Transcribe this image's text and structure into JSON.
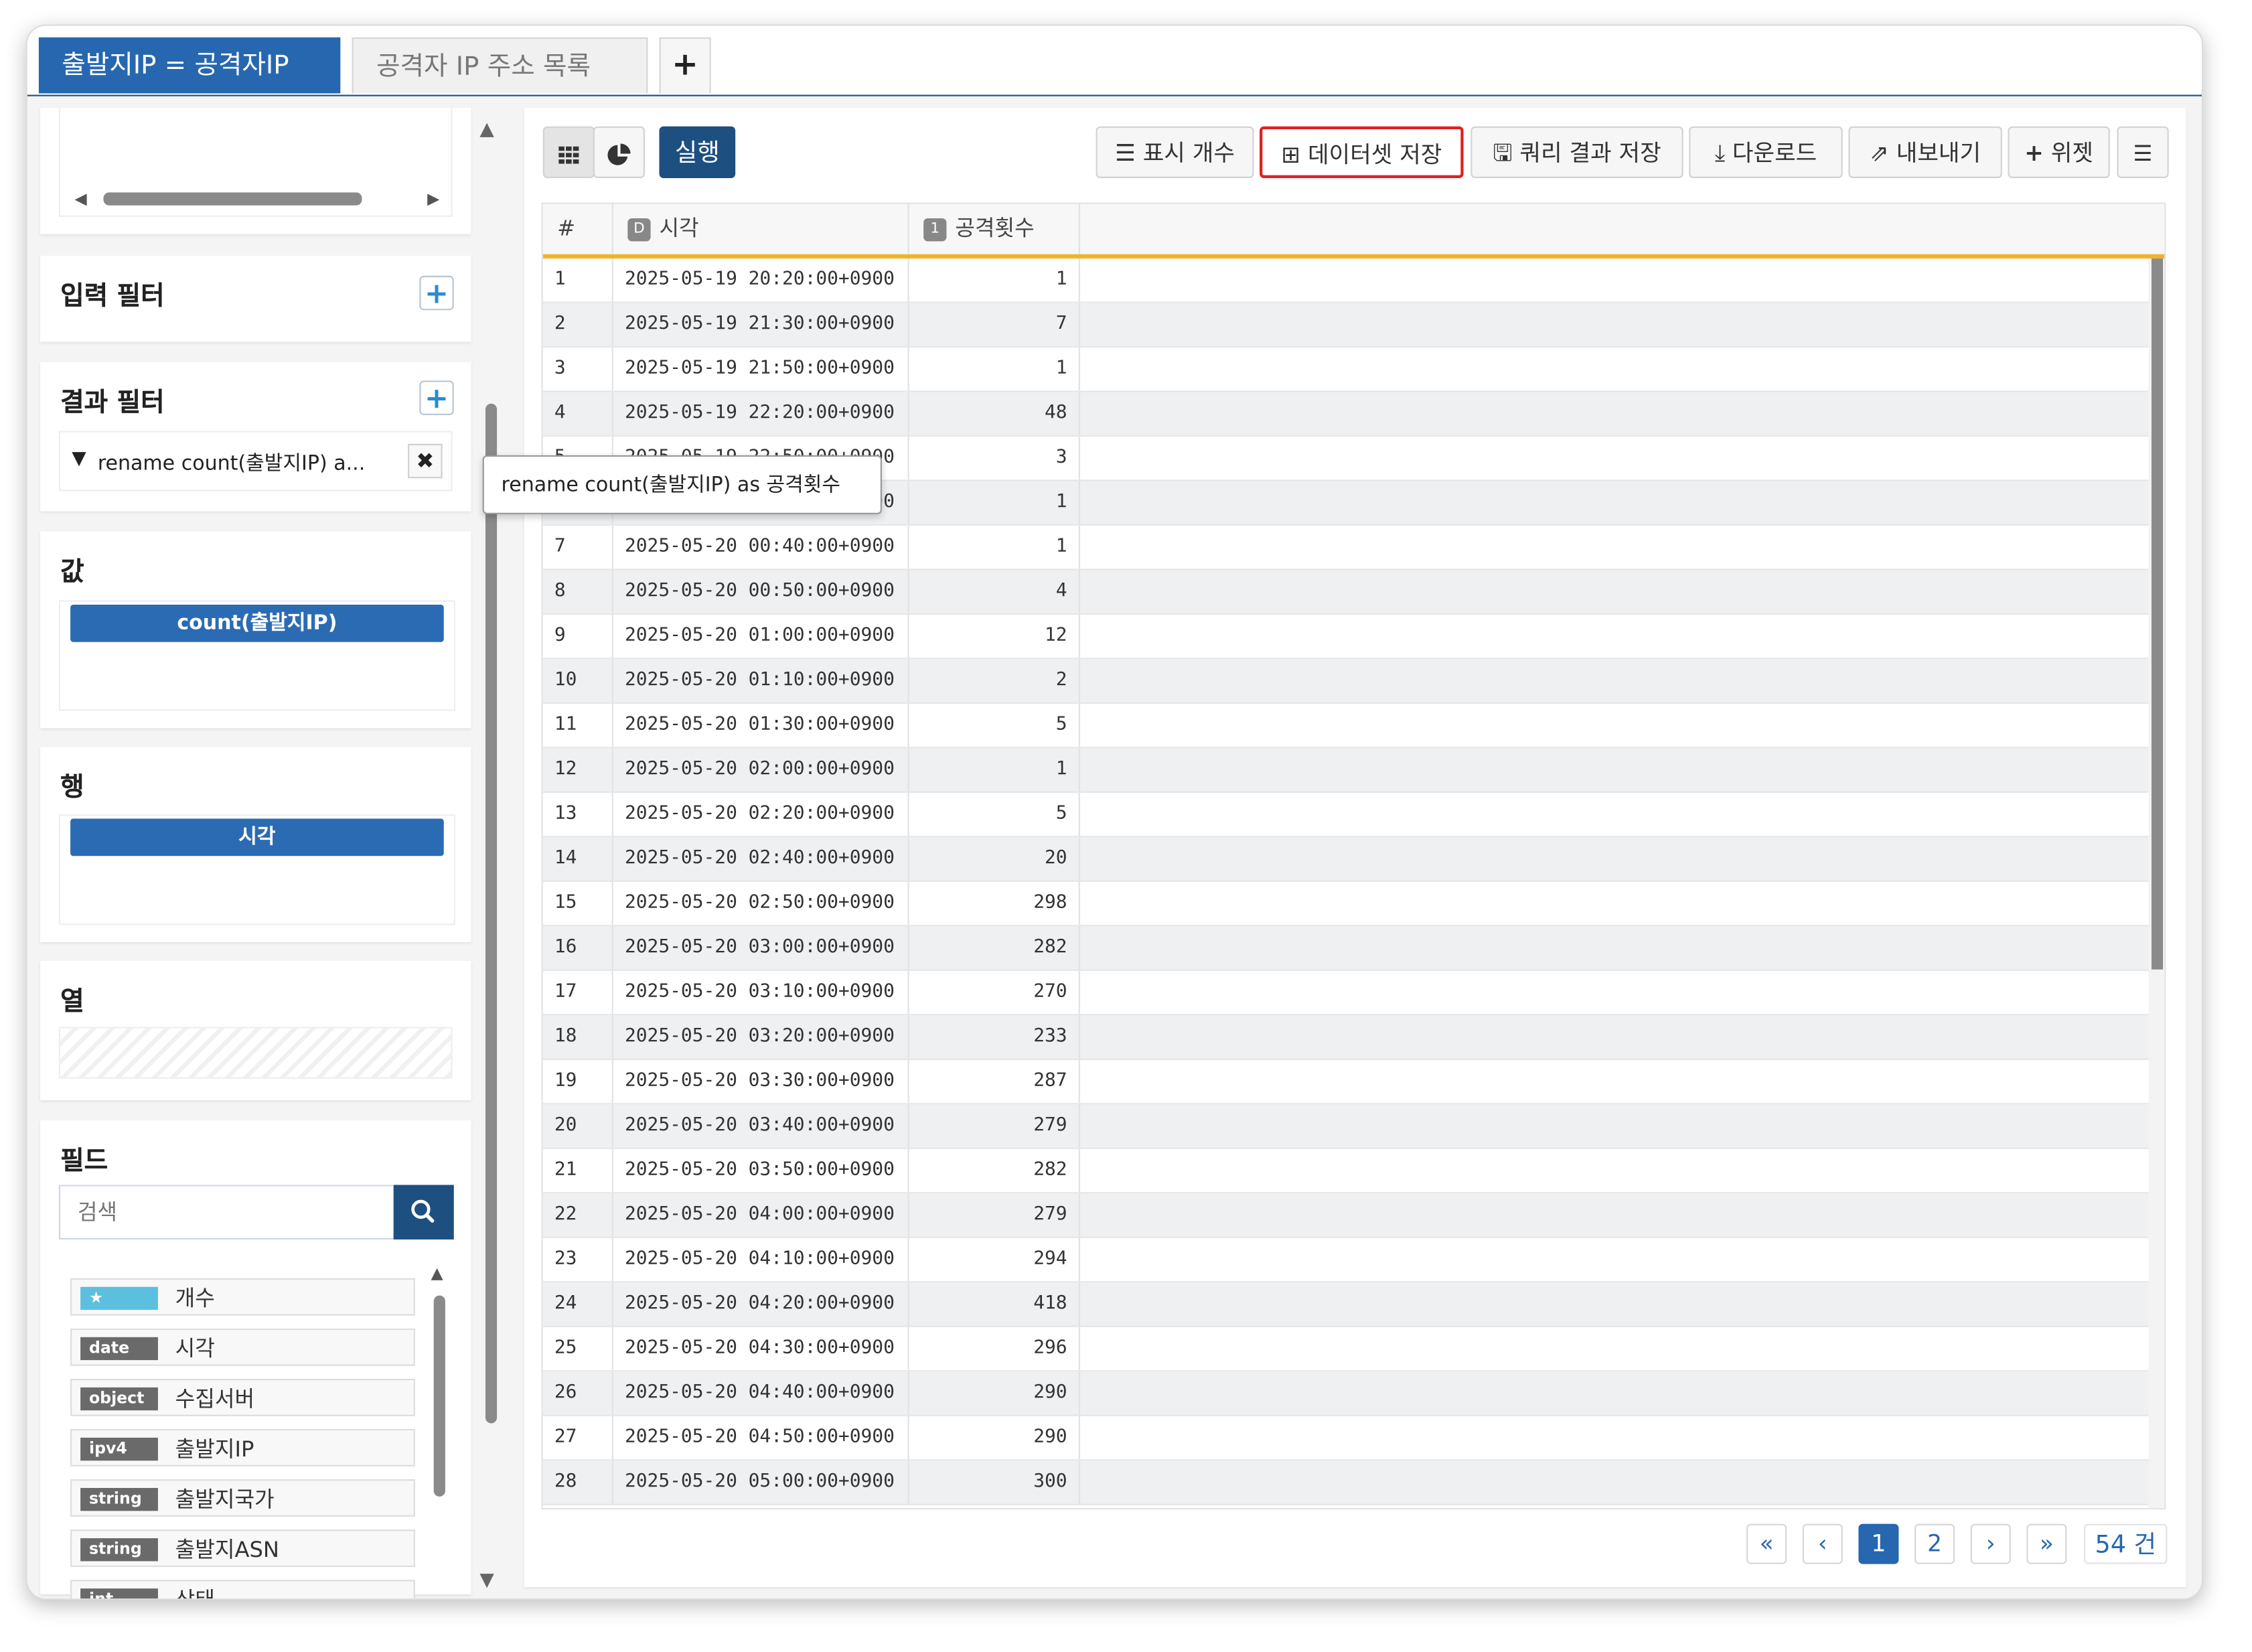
{
  "tabs": [
    {
      "label": "출발지IP = 공격자IP",
      "active": true
    },
    {
      "label": "공격자 IP 주소 목록",
      "active": false
    }
  ],
  "tab_add_label": "+",
  "left": {
    "input_filter": {
      "title": "입력 필터",
      "add_icon": "plus-icon"
    },
    "result_filter": {
      "title": "결과 필터",
      "filter_text": "rename count(출발지IP) a...",
      "remove_icon": "close-icon"
    },
    "tooltip": "rename count(출발지IP) as 공격횟수",
    "value": {
      "title": "값",
      "pill": "count(출발지IP)"
    },
    "row": {
      "title": "행",
      "pill": "시각"
    },
    "column": {
      "title": "열"
    },
    "fields": {
      "title": "필드",
      "search_placeholder": "검색",
      "items": [
        {
          "type": "★",
          "name": "개수",
          "badge_color": "#5bc0de"
        },
        {
          "type": "date",
          "name": "시각",
          "badge_color": "#6a6a6a"
        },
        {
          "type": "object",
          "name": "수집서버",
          "badge_color": "#6a6a6a"
        },
        {
          "type": "ipv4",
          "name": "출발지IP",
          "badge_color": "#6a6a6a"
        },
        {
          "type": "string",
          "name": "출발지국가",
          "badge_color": "#6a6a6a"
        },
        {
          "type": "string",
          "name": "출발지ASN",
          "badge_color": "#6a6a6a"
        },
        {
          "type": "int",
          "name": "상태",
          "badge_color": "#6a6a6a"
        }
      ]
    }
  },
  "toolbar": {
    "run_label": "실행",
    "display_count": "표시 개수",
    "save_dataset": "데이터셋 저장",
    "save_query_result": "쿼리 결과 저장",
    "download": "다운로드",
    "export": "내보내기",
    "widget": "위젯"
  },
  "grid": {
    "headers": {
      "index": "#",
      "time": "시각",
      "time_type": "D",
      "count": "공격횟수",
      "count_type": "1"
    },
    "rows": [
      [
        "1",
        "2025-05-19 20:20:00+0900",
        "1"
      ],
      [
        "2",
        "2025-05-19 21:30:00+0900",
        "7"
      ],
      [
        "3",
        "2025-05-19 21:50:00+0900",
        "1"
      ],
      [
        "4",
        "2025-05-19 22:20:00+0900",
        "48"
      ],
      [
        "5",
        "2025-05-19 22:50:00+0900",
        "3"
      ],
      [
        "6",
        "2025-05-20 00:30:00+0900",
        "1"
      ],
      [
        "7",
        "2025-05-20 00:40:00+0900",
        "1"
      ],
      [
        "8",
        "2025-05-20 00:50:00+0900",
        "4"
      ],
      [
        "9",
        "2025-05-20 01:00:00+0900",
        "12"
      ],
      [
        "10",
        "2025-05-20 01:10:00+0900",
        "2"
      ],
      [
        "11",
        "2025-05-20 01:30:00+0900",
        "5"
      ],
      [
        "12",
        "2025-05-20 02:00:00+0900",
        "1"
      ],
      [
        "13",
        "2025-05-20 02:20:00+0900",
        "5"
      ],
      [
        "14",
        "2025-05-20 02:40:00+0900",
        "20"
      ],
      [
        "15",
        "2025-05-20 02:50:00+0900",
        "298"
      ],
      [
        "16",
        "2025-05-20 03:00:00+0900",
        "282"
      ],
      [
        "17",
        "2025-05-20 03:10:00+0900",
        "270"
      ],
      [
        "18",
        "2025-05-20 03:20:00+0900",
        "233"
      ],
      [
        "19",
        "2025-05-20 03:30:00+0900",
        "287"
      ],
      [
        "20",
        "2025-05-20 03:40:00+0900",
        "279"
      ],
      [
        "21",
        "2025-05-20 03:50:00+0900",
        "282"
      ],
      [
        "22",
        "2025-05-20 04:00:00+0900",
        "279"
      ],
      [
        "23",
        "2025-05-20 04:10:00+0900",
        "294"
      ],
      [
        "24",
        "2025-05-20 04:20:00+0900",
        "418"
      ],
      [
        "25",
        "2025-05-20 04:30:00+0900",
        "296"
      ],
      [
        "26",
        "2025-05-20 04:40:00+0900",
        "290"
      ],
      [
        "27",
        "2025-05-20 04:50:00+0900",
        "290"
      ],
      [
        "28",
        "2025-05-20 05:00:00+0900",
        "300"
      ]
    ]
  },
  "pager": {
    "first": "«",
    "prev": "‹",
    "pages": [
      "1",
      "2"
    ],
    "current": "1",
    "next": "›",
    "last": "»",
    "total": "54 건"
  },
  "colors": {
    "primary": "#2667b0",
    "highlight_border": "#e02020",
    "header_underline": "#f0b429"
  }
}
